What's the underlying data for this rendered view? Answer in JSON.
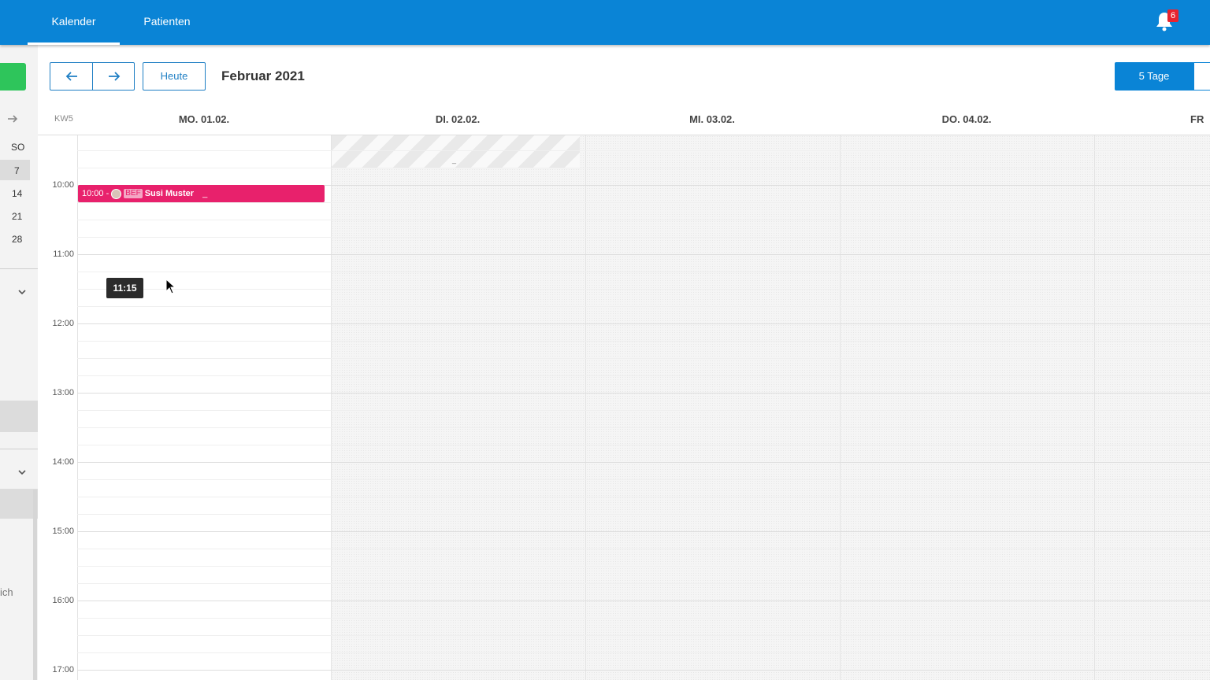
{
  "nav": {
    "tabs": [
      {
        "label": "Kalender",
        "active": true
      },
      {
        "label": "Patienten",
        "active": false
      }
    ],
    "notification_count": "6"
  },
  "sidebar": {
    "weekday_label": "SO",
    "days": [
      "7",
      "14",
      "21",
      "28"
    ],
    "partial_text": "ich"
  },
  "toolbar": {
    "today_label": "Heute",
    "month_title": "Februar 2021",
    "view_label": "5 Tage"
  },
  "calendar": {
    "week_label": "KW5",
    "days": [
      "MO. 01.02.",
      "DI. 02.02.",
      "MI. 03.02.",
      "DO. 04.02.",
      "FR"
    ],
    "hours": [
      "10:00",
      "11:00",
      "12:00",
      "13:00",
      "14:00",
      "15:00",
      "16:00",
      "17:00"
    ],
    "hatch_mark": "_"
  },
  "event": {
    "time": "10:00 -",
    "tag": "BEF",
    "patient": "Susi Muster",
    "extra": "_"
  },
  "hover_tooltip": "11:15",
  "colors": {
    "nav_bg": "#0a84d6",
    "event_bg": "#e8216c",
    "new_button": "#2ec55b"
  }
}
